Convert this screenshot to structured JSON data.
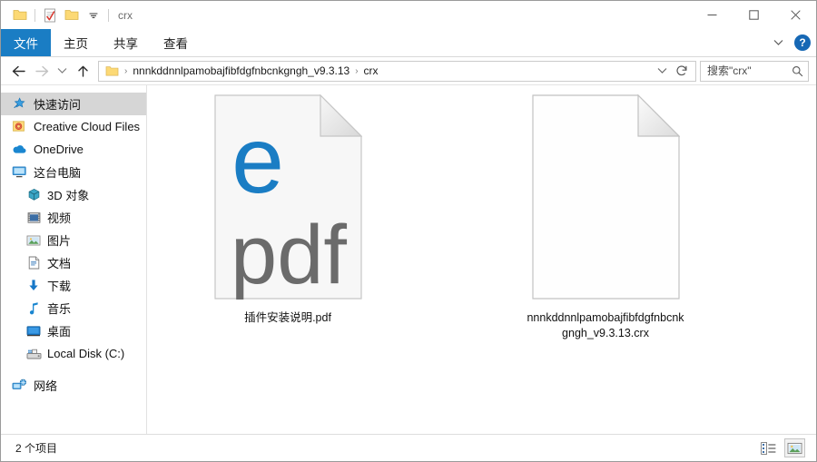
{
  "window": {
    "title": "crx",
    "quick_access_toolbar": [
      {
        "name": "folder-icon",
        "label": "folder"
      },
      {
        "name": "properties-icon",
        "label": "properties"
      },
      {
        "name": "new-folder-icon",
        "label": "new folder"
      },
      {
        "name": "customize-qat-chevron-icon",
        "label": "customize"
      }
    ],
    "controls": {
      "minimize": "minimize",
      "maximize": "maximize",
      "close": "close"
    }
  },
  "ribbon": {
    "tabs": [
      {
        "label": "文件",
        "selected": true
      },
      {
        "label": "主页",
        "selected": false
      },
      {
        "label": "共享",
        "selected": false
      },
      {
        "label": "查看",
        "selected": false
      }
    ],
    "expand_label": "",
    "help_label": "?"
  },
  "nav": {
    "back": "←",
    "forward": "→",
    "recent": "⌄",
    "up": "↑",
    "breadcrumbs": [
      "nnnkddnnlpamobajfibfdgfnbcnkgngh_v9.3.13",
      "crx"
    ],
    "separator": "›",
    "address_dropdown": "⌄",
    "refresh": "↻"
  },
  "search": {
    "value": "",
    "placeholder": "搜索\"crx\""
  },
  "sidebar": {
    "items": [
      {
        "label": "快速访问",
        "icon": "pin-star-icon",
        "selected": true,
        "indent": false
      },
      {
        "label": "Creative Cloud Files",
        "icon": "creative-cloud-folder-icon",
        "selected": false,
        "indent": false
      },
      {
        "label": "OneDrive",
        "icon": "cloud-icon",
        "selected": false,
        "indent": false
      },
      {
        "label": "这台电脑",
        "icon": "monitor-icon",
        "selected": false,
        "indent": false
      },
      {
        "label": "3D 对象",
        "icon": "cube-icon",
        "selected": false,
        "indent": true
      },
      {
        "label": "视频",
        "icon": "film-icon",
        "selected": false,
        "indent": true
      },
      {
        "label": "图片",
        "icon": "picture-icon",
        "selected": false,
        "indent": true
      },
      {
        "label": "文档",
        "icon": "document-icon",
        "selected": false,
        "indent": true
      },
      {
        "label": "下载",
        "icon": "download-arrow-icon",
        "selected": false,
        "indent": true
      },
      {
        "label": "音乐",
        "icon": "music-note-icon",
        "selected": false,
        "indent": true
      },
      {
        "label": "桌面",
        "icon": "desktop-icon",
        "selected": false,
        "indent": true
      },
      {
        "label": "Local Disk (C:)",
        "icon": "hard-disk-icon",
        "selected": false,
        "indent": true
      },
      {
        "label": "网络",
        "icon": "network-icon",
        "selected": false,
        "indent": false
      }
    ]
  },
  "files": [
    {
      "name": "插件安装说明.pdf",
      "icon": "pdf-edge-file-icon",
      "icon_text": "pdf",
      "selected": false
    },
    {
      "name": "nnnkddnnlpamobajfibfdgfnbcnkgngh_v9.3.13.crx",
      "icon": "blank-file-icon",
      "icon_text": "",
      "selected": false
    }
  ],
  "status": {
    "item_count_text": "2 个项目",
    "views": [
      {
        "name": "details-view",
        "active": false
      },
      {
        "name": "large-icons-view",
        "active": true
      }
    ]
  },
  "colors": {
    "accent": "#1a7dc4",
    "edge_blue": "#1a7dc4",
    "pdf_grey": "#6b6b6b",
    "folder_yellow": "#fcd975",
    "selection_grey": "#d6d6d6"
  }
}
